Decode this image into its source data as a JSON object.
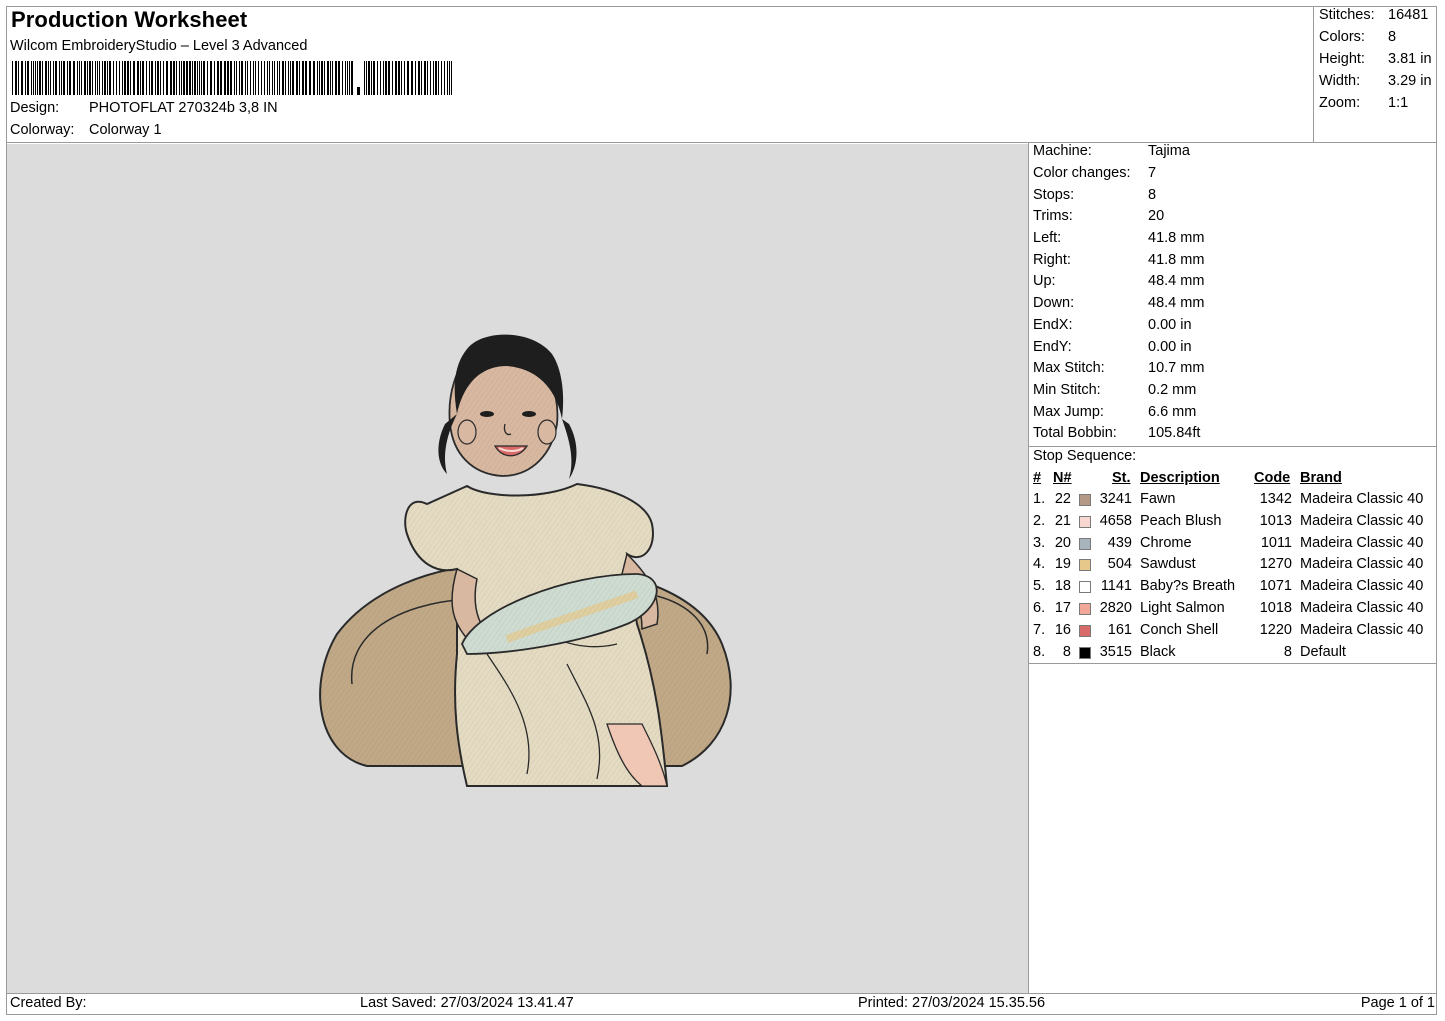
{
  "header": {
    "title": "Production Worksheet",
    "software": "Wilcom EmbroideryStudio – Level 3 Advanced",
    "design_label": "Design:",
    "design_value": "PHOTOFLAT 270324b 3,8 IN",
    "colorway_label": "Colorway:",
    "colorway_value": "Colorway 1"
  },
  "summary": [
    {
      "label": "Stitches:",
      "value": "16481"
    },
    {
      "label": "Colors:",
      "value": "8"
    },
    {
      "label": "Height:",
      "value": "3.81 in"
    },
    {
      "label": "Width:",
      "value": "3.29 in"
    },
    {
      "label": "Zoom:",
      "value": "1:1"
    }
  ],
  "machine_info": [
    {
      "label": "Machine:",
      "value": "Tajima"
    },
    {
      "label": "Color changes:",
      "value": "7"
    },
    {
      "label": "Stops:",
      "value": "8"
    },
    {
      "label": "Trims:",
      "value": "20"
    },
    {
      "label": "Left:",
      "value": "41.8 mm"
    },
    {
      "label": "Right:",
      "value": "41.8 mm"
    },
    {
      "label": "Up:",
      "value": "48.4 mm"
    },
    {
      "label": "Down:",
      "value": "48.4 mm"
    },
    {
      "label": "EndX:",
      "value": "0.00 in"
    },
    {
      "label": "EndY:",
      "value": "0.00 in"
    },
    {
      "label": "Max Stitch:",
      "value": "10.7 mm"
    },
    {
      "label": "Min Stitch:",
      "value": "0.2 mm"
    },
    {
      "label": "Max Jump:",
      "value": "6.6 mm"
    },
    {
      "label": "Total Bobbin:",
      "value": "105.84ft"
    }
  ],
  "stop_sequence": {
    "title": "Stop Sequence:",
    "headers": {
      "num": "#",
      "n": "N#",
      "st": "St.",
      "description": "Description",
      "code": "Code",
      "brand": "Brand"
    },
    "rows": [
      {
        "num": "1.",
        "n": "22",
        "color": "#b49a86",
        "st": "3241",
        "description": "Fawn",
        "code": "1342",
        "brand": "Madeira Classic 40"
      },
      {
        "num": "2.",
        "n": "21",
        "color": "#f7d7cf",
        "st": "4658",
        "description": "Peach Blush",
        "code": "1013",
        "brand": "Madeira Classic 40"
      },
      {
        "num": "3.",
        "n": "20",
        "color": "#a8b4bc",
        "st": "439",
        "description": "Chrome",
        "code": "1011",
        "brand": "Madeira Classic 40"
      },
      {
        "num": "4.",
        "n": "19",
        "color": "#e6c98a",
        "st": "504",
        "description": "Sawdust",
        "code": "1270",
        "brand": "Madeira Classic 40"
      },
      {
        "num": "5.",
        "n": "18",
        "color": "#ffffff",
        "st": "1141",
        "description": "Baby?s Breath",
        "code": "1071",
        "brand": "Madeira Classic 40"
      },
      {
        "num": "6.",
        "n": "17",
        "color": "#f2a898",
        "st": "2820",
        "description": "Light Salmon",
        "code": "1018",
        "brand": "Madeira Classic 40"
      },
      {
        "num": "7.",
        "n": "16",
        "color": "#d86a6a",
        "st": "161",
        "description": "Conch Shell",
        "code": "1220",
        "brand": "Madeira Classic 40"
      },
      {
        "num": "8.",
        "n": "8",
        "color": "#000000",
        "st": "3515",
        "description": "Black",
        "code": "8",
        "brand": "Default"
      }
    ]
  },
  "footer": {
    "created_by": "Created By:",
    "last_saved": "Last Saved: 27/03/2024 13.41.47",
    "printed": "Printed: 27/03/2024 15.35.56",
    "page": "Page 1 of 1"
  }
}
